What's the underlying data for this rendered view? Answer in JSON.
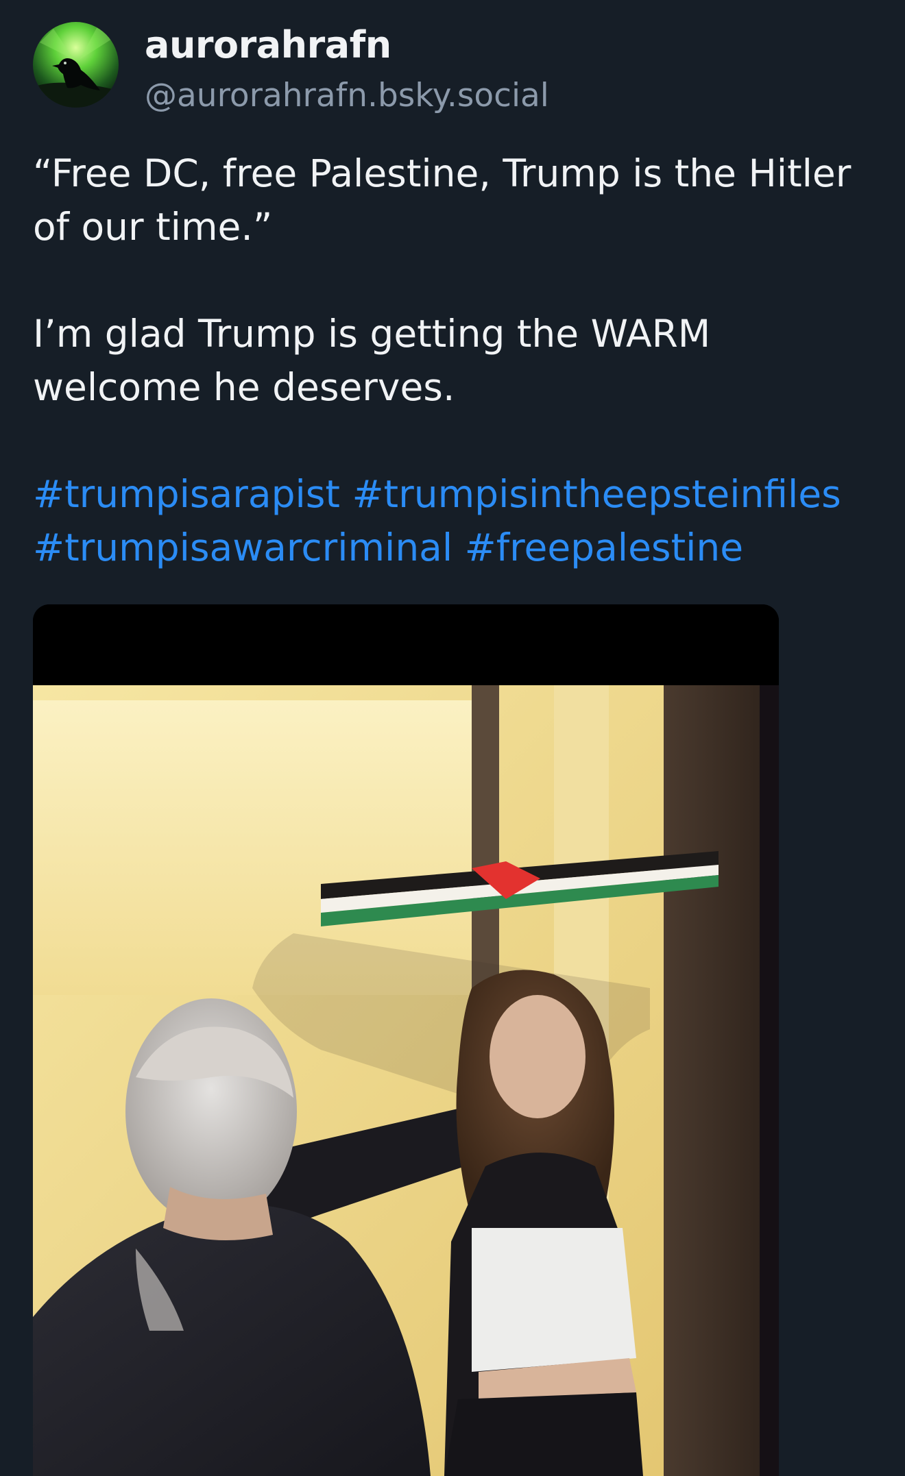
{
  "post": {
    "author": {
      "display_name": "aurorahrafn",
      "handle": "@aurorahrafn.bsky.social",
      "avatar_icon": "raven-aurora-avatar"
    },
    "text_paragraphs": [
      "“Free DC, free Palestine, Trump is the Hitler of our time.”",
      "I’m glad Trump is getting the WARM welcome he deserves."
    ],
    "hashtags": [
      "#trumpisarapist",
      "#trumpisintheepsteinfiles",
      "#trumpisawarcriminal",
      "#freepalestine"
    ],
    "media": {
      "type": "video-thumbnail"
    },
    "colors": {
      "background": "#161e27",
      "text": "#f1f3f5",
      "handle": "#8c9aab",
      "link": "#2b8cf5"
    }
  }
}
